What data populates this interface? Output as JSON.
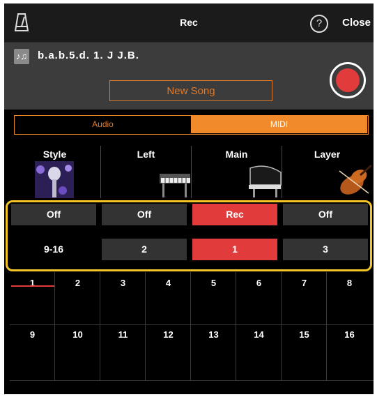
{
  "header": {
    "title": "Rec",
    "close_label": "Close",
    "help_symbol": "?"
  },
  "song": {
    "name": "b.a.b.5.d. 1. J J.B.",
    "icon_glyph": "♪♫",
    "new_song_label": "New Song"
  },
  "mode_tabs": {
    "audio_label": "Audio",
    "midi_label": "MIDI",
    "selected": "MIDI"
  },
  "parts": [
    {
      "label": "Style"
    },
    {
      "label": "Left"
    },
    {
      "label": "Main"
    },
    {
      "label": "Layer"
    }
  ],
  "part_status": [
    "Off",
    "Off",
    "Rec",
    "Off"
  ],
  "channels": {
    "range_label": "9-16",
    "values": [
      "2",
      "1",
      "3"
    ]
  },
  "tracks": [
    "1",
    "2",
    "3",
    "4",
    "5",
    "6",
    "7",
    "8",
    "9",
    "10",
    "11",
    "12",
    "13",
    "14",
    "15",
    "16"
  ],
  "colors": {
    "accent": "#f08a2a",
    "record": "#e23b3b",
    "highlight": "#f5c525"
  },
  "icons": {
    "metronome": "metronome-icon",
    "help": "help-icon",
    "song": "music-note-icon",
    "record": "record-icon"
  }
}
